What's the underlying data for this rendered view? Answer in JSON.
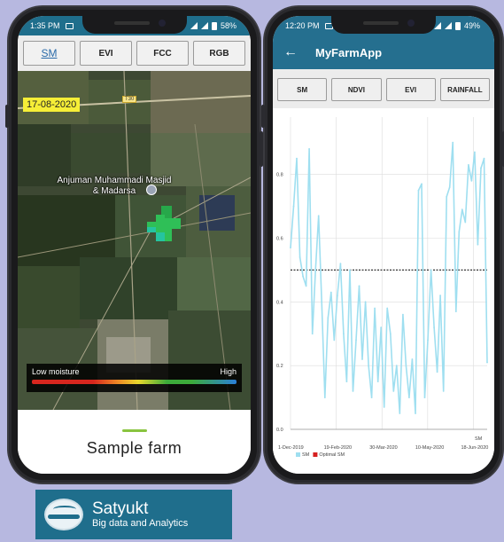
{
  "left_phone": {
    "status": {
      "time": "1:35 PM",
      "battery": "58%"
    },
    "layer_tabs": [
      {
        "label": "SM",
        "active": true
      },
      {
        "label": "EVI",
        "active": false
      },
      {
        "label": "FCC",
        "active": false
      },
      {
        "label": "RGB",
        "active": false
      }
    ],
    "map": {
      "date": "17-08-2020",
      "road_label": "T30",
      "place_label": "Anjuman Muhammadi Masjid & Madarsa"
    },
    "legend": {
      "low": "Low moisture",
      "high": "High"
    },
    "farm_title": "Sample farm"
  },
  "right_phone": {
    "status": {
      "time": "12:20 PM",
      "battery": "49%"
    },
    "app_title": "MyFarmApp",
    "graph_tabs": [
      "SM",
      "NDVI",
      "EVI",
      "RAINFALL"
    ],
    "chart_data": {
      "type": "line",
      "title": "",
      "x_tick_labels": [
        "1-Dec-2019",
        "19-Feb-2020",
        "30-Mar-2020",
        "10-May-2020",
        "18-Jun-2020"
      ],
      "y_ticks": [
        "0.0",
        "0.2",
        "0.4",
        "0.6",
        "0.8"
      ],
      "ylim": [
        0,
        0.98
      ],
      "y_axis_label": "SM",
      "grid": true,
      "legend": {
        "placement": "bottom-left",
        "entries": [
          {
            "name": "SM",
            "color": "#9fdff0"
          },
          {
            "name": "Optimal SM",
            "color": "#d62020"
          }
        ]
      },
      "optimal_sm": 0.5,
      "series": [
        {
          "name": "SM",
          "color": "#9fdff0",
          "values": [
            0.57,
            0.7,
            0.85,
            0.54,
            0.48,
            0.45,
            0.88,
            0.3,
            0.5,
            0.67,
            0.4,
            0.1,
            0.35,
            0.43,
            0.28,
            0.42,
            0.52,
            0.3,
            0.15,
            0.5,
            0.12,
            0.28,
            0.45,
            0.22,
            0.4,
            0.2,
            0.1,
            0.38,
            0.15,
            0.32,
            0.07,
            0.38,
            0.3,
            0.12,
            0.2,
            0.05,
            0.36,
            0.2,
            0.1,
            0.22,
            0.05,
            0.75,
            0.77,
            0.1,
            0.28,
            0.5,
            0.32,
            0.18,
            0.42,
            0.12,
            0.73,
            0.76,
            0.9,
            0.37,
            0.62,
            0.69,
            0.65,
            0.83,
            0.78,
            0.87,
            0.58,
            0.82,
            0.85,
            0.21
          ]
        }
      ]
    }
  },
  "brand": {
    "name": "Satyukt",
    "tagline": "Big data and Analytics"
  }
}
